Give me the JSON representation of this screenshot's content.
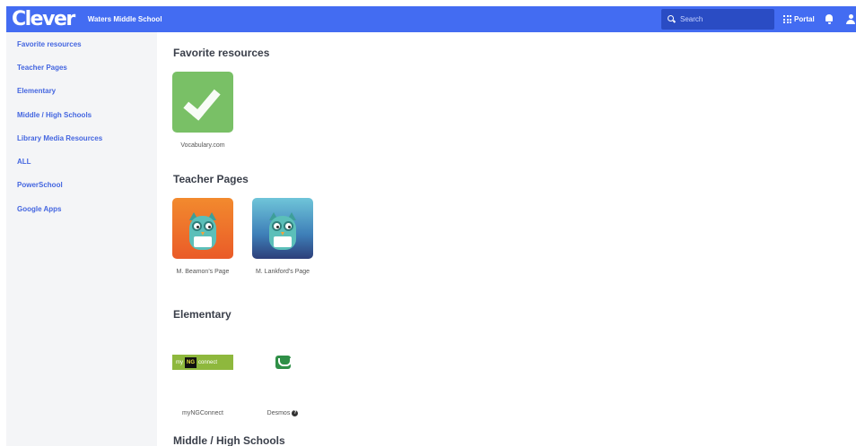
{
  "header": {
    "logo": "Clever",
    "school": "Waters Middle School",
    "search_placeholder": "Search",
    "portal_label": "Portal"
  },
  "sidebar": {
    "items": [
      {
        "label": "Favorite resources"
      },
      {
        "label": "Teacher Pages"
      },
      {
        "label": "Elementary"
      },
      {
        "label": "Middle / High Schools"
      },
      {
        "label": "Library Media Resources"
      },
      {
        "label": "ALL"
      },
      {
        "label": "PowerSchool"
      },
      {
        "label": "Google Apps"
      }
    ]
  },
  "sections": [
    {
      "title": "Favorite resources",
      "apps": [
        {
          "label": "Vocabulary.com",
          "icon": "check-icon",
          "color": "#79c066"
        }
      ]
    },
    {
      "title": "Teacher Pages",
      "apps": [
        {
          "label": "M. Beamon's Page",
          "icon": "owl-icon",
          "color": "#ea5b28"
        },
        {
          "label": "M. Lankford's Page",
          "icon": "owl-icon",
          "color": "#3e7fb8"
        }
      ]
    },
    {
      "title": "Elementary",
      "apps": [
        {
          "label": "myNGConnect",
          "logo_text": [
            "my",
            "NG",
            "connect"
          ],
          "icon": "myngconnect-logo",
          "color": "#8eb83d"
        },
        {
          "label": "Desmos",
          "icon": "desmos-logo",
          "color": "#2f8f47",
          "help": "?"
        }
      ]
    },
    {
      "title": "Middle / High Schools"
    }
  ],
  "colors": {
    "accent": "#436cf2",
    "sidebar_bg": "#f4f5f7",
    "link": "#4466e0"
  }
}
